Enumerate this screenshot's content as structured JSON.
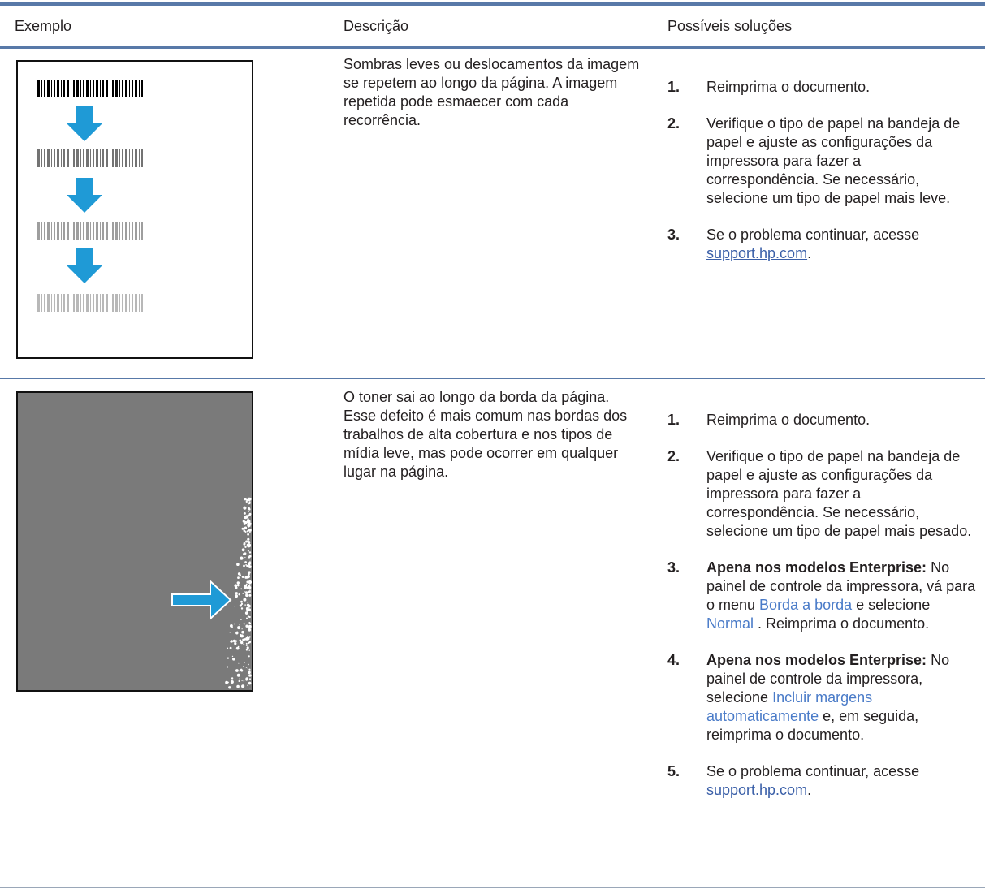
{
  "header": {
    "col_example": "Exemplo",
    "col_description": "Descrição",
    "col_solutions": "Possíveis soluções"
  },
  "rows": [
    {
      "example_image": "repeated-barcode-ghost-image",
      "description": "Sombras leves ou deslocamentos da imagem se repetem ao longo da página. A imagem repetida pode esmaecer com cada recorrência.",
      "steps": [
        {
          "num": "1.",
          "text": "Reimprima o documento."
        },
        {
          "num": "2.",
          "text": "Verifique o tipo de papel na bandeja de papel e ajuste as configurações da impressora para fazer a correspondência. Se necessário, selecione um tipo de papel mais leve."
        },
        {
          "num": "3.",
          "text": "Se o problema continuar, acesse ",
          "link": "support.hp.com",
          "suffix": "."
        }
      ]
    },
    {
      "example_image": "toner-edge-scatter-image",
      "description": "O toner sai ao longo da borda da página. Esse defeito é mais comum nas bordas dos trabalhos de alta cobertura e nos tipos de mídia leve, mas pode ocorrer em qualquer lugar na página.",
      "steps": [
        {
          "num": "1.",
          "text": "Reimprima o documento."
        },
        {
          "num": "2.",
          "text": "Verifique o tipo de papel na bandeja de papel e ajuste as configurações da impressora para fazer a correspondência. Se necessário, selecione um tipo de papel mais pesado."
        },
        {
          "num": "3.",
          "bold": "Apena nos modelos Enterprise:",
          "text_a": " No painel de controle da impressora, vá para o menu ",
          "menu_a": "Borda a borda",
          "text_b": " e selecione ",
          "menu_b": "Normal",
          "text_c": " . Reimprima o documento."
        },
        {
          "num": "4.",
          "bold": "Apena nos modelos Enterprise:",
          "text_a": " No painel de controle da impressora, selecione ",
          "menu_a": "Incluir margens automaticamente",
          "text_b": " e, em seguida, reimprima o documento."
        },
        {
          "num": "5.",
          "text": "Se o problema continuar, acesse ",
          "link": "support.hp.com",
          "suffix": "."
        }
      ]
    }
  ],
  "colors": {
    "rule": "#5879a8",
    "arrow": "#1f9ad6",
    "link": "#3a5fa8",
    "menu": "#4a7bc8",
    "gray_page": "#7a7a7a"
  }
}
